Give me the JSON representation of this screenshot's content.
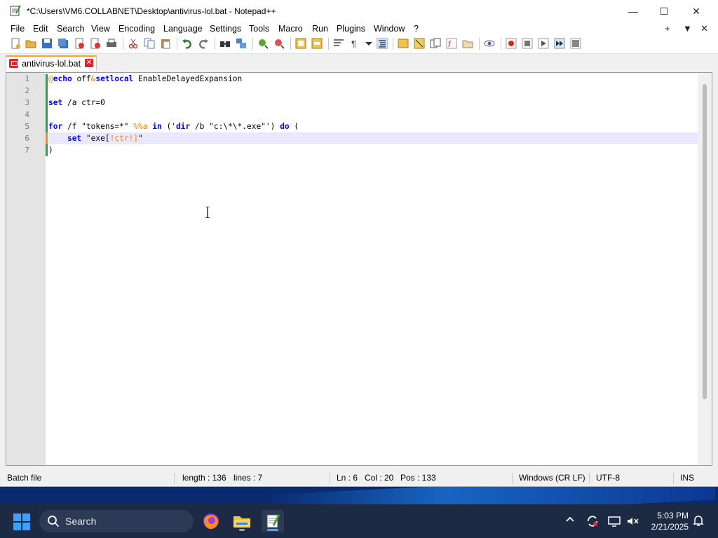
{
  "window": {
    "title": "*C:\\Users\\VM6.COLLABNET\\Desktop\\antivirus-lol.bat - Notepad++",
    "controls": {
      "minimize": "—",
      "maximize": "☐",
      "close": "✕"
    }
  },
  "menu": {
    "items": [
      "File",
      "Edit",
      "Search",
      "View",
      "Encoding",
      "Language",
      "Settings",
      "Tools",
      "Macro",
      "Run",
      "Plugins",
      "Window",
      "?"
    ],
    "right": {
      "plus": "+",
      "dropdown": "▼",
      "close": "✕"
    }
  },
  "tab": {
    "label": "antivirus-lol.bat",
    "close": "✕"
  },
  "editor": {
    "line_numbers": [
      "1",
      "2",
      "3",
      "4",
      "5",
      "6",
      "7"
    ],
    "lines": [
      [
        {
          "t": "@",
          "c": "at"
        },
        {
          "t": "echo",
          "c": "kw"
        },
        {
          "t": " off",
          "c": "str"
        },
        {
          "t": "&",
          "c": "at"
        },
        {
          "t": "setlocal",
          "c": "kw"
        },
        {
          "t": " EnableDelayedExpansion",
          "c": "str"
        }
      ],
      [],
      [
        {
          "t": "set",
          "c": "kw"
        },
        {
          "t": " /a ctr=0",
          "c": "str"
        }
      ],
      [],
      [
        {
          "t": "for",
          "c": "kw"
        },
        {
          "t": " /f \"tokens=*\" ",
          "c": "str"
        },
        {
          "t": "%%a",
          "c": "var"
        },
        {
          "t": " ",
          "c": "str"
        },
        {
          "t": "in",
          "c": "kw"
        },
        {
          "t": " ('",
          "c": "str"
        },
        {
          "t": "dir",
          "c": "kw"
        },
        {
          "t": " /b \"c:\\*\\*.exe\"') ",
          "c": "str"
        },
        {
          "t": "do",
          "c": "kw"
        },
        {
          "t": " (",
          "c": "str"
        }
      ],
      [
        {
          "t": "    ",
          "c": "str"
        },
        {
          "t": "set",
          "c": "kw"
        },
        {
          "t": " \"exe[",
          "c": "str"
        },
        {
          "t": "!ctr!",
          "c": "var"
        },
        {
          "t": "]",
          "c": "var"
        },
        {
          "t": "\"",
          "c": "str"
        }
      ],
      [
        {
          "t": ")",
          "c": "str"
        }
      ]
    ]
  },
  "status": {
    "file_type": "Batch file",
    "length": "length : 136",
    "lines": "lines : 7",
    "ln": "Ln : 6",
    "col": "Col : 20",
    "pos": "Pos : 133",
    "eol": "Windows (CR LF)",
    "encoding": "UTF-8",
    "mode": "INS"
  },
  "taskbar": {
    "search_placeholder": "Search",
    "time": "5:03 PM",
    "date": "2/21/2025"
  },
  "colors": {
    "keyword": "#0000ff",
    "operator": "#ff8000",
    "tab_accent": "#f2a33a",
    "current_line": "#e8e8ff",
    "saved_marker": "#25a54a",
    "modified_marker": "#f08a24"
  }
}
